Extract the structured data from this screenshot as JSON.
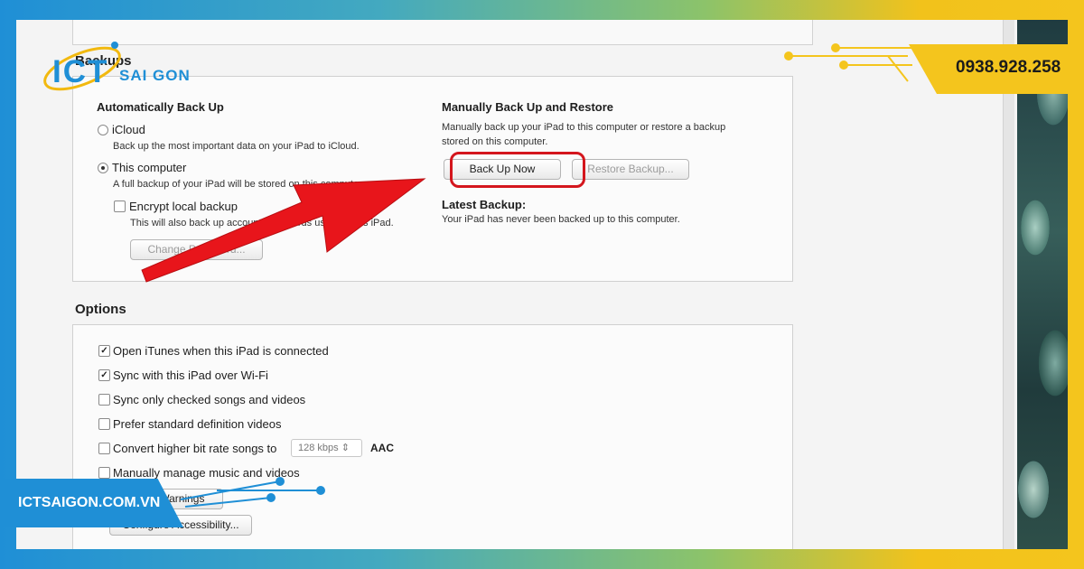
{
  "backups": {
    "title": "Backups",
    "auto": {
      "heading": "Automatically Back Up",
      "icloud_label": "iCloud",
      "icloud_desc": "Back up the most important data on your iPad to iCloud.",
      "computer_label": "This computer",
      "computer_desc": "A full backup of your iPad will be stored on this computer.",
      "encrypt_label": "Encrypt local backup",
      "encrypt_desc": "This will also back up account passwords used on this iPad.",
      "change_password_label": "Change Password..."
    },
    "manual": {
      "heading": "Manually Back Up and Restore",
      "desc_line1": "Manually back up your iPad to this computer or restore a backup",
      "desc_line2": "stored on this computer.",
      "backup_now_label": "Back Up Now",
      "restore_label": "Restore Backup...",
      "latest_heading": "Latest Backup:",
      "latest_desc": "Your iPad has never been backed up to this computer."
    }
  },
  "options": {
    "title": "Options",
    "items": [
      {
        "label": "Open iTunes when this iPad is connected",
        "checked": true
      },
      {
        "label": "Sync with this iPad over Wi-Fi",
        "checked": true
      },
      {
        "label": "Sync only checked songs and videos",
        "checked": false
      },
      {
        "label": "Prefer standard definition videos",
        "checked": false
      },
      {
        "label": "Convert higher bit rate songs to",
        "checked": false
      },
      {
        "label": "Manually manage music and videos",
        "checked": false
      }
    ],
    "bitrate_value": "128 kbps",
    "bitrate_format": "AAC",
    "reset_warnings_label": "Reset Warnings",
    "accessibility_label": "Configure Accessibility..."
  },
  "branding": {
    "logo_ict": "ICT",
    "logo_saigon": "SAI GON",
    "phone": "0938.928.258",
    "website": "ICTSAIGON.COM.VN"
  },
  "colors": {
    "highlight": "#d4161d",
    "arrow": "#e8151b",
    "brand_blue": "#1f8fd6",
    "brand_yellow": "#f4c51d"
  }
}
